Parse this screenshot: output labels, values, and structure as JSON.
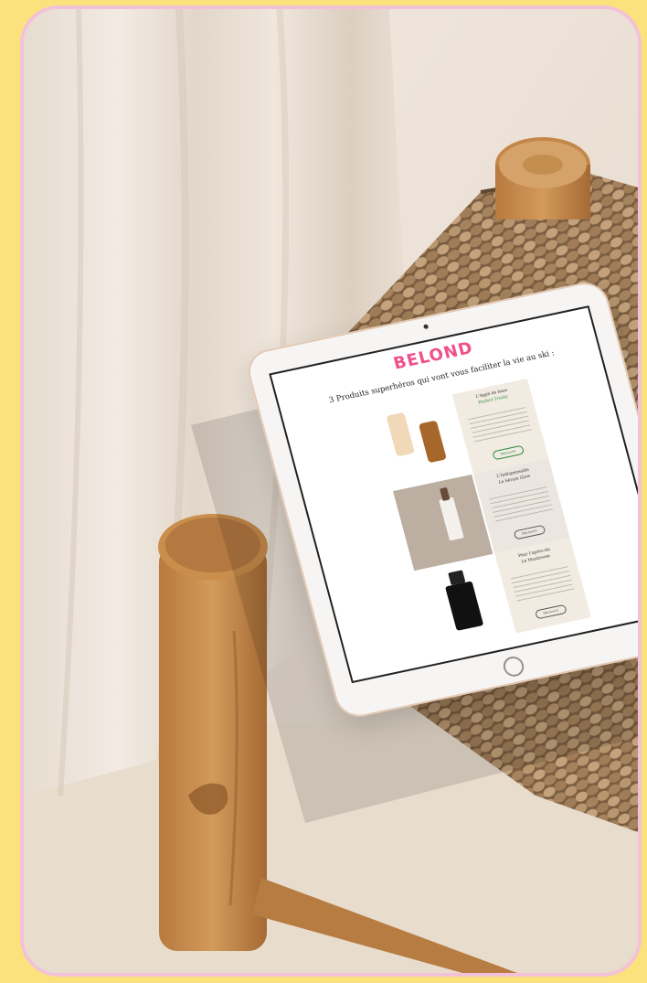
{
  "brand": {
    "logo_text": "BELOND"
  },
  "email": {
    "headline": "3 Produits superhéros qui vont vous faciliter la vie au ski :",
    "products": [
      {
        "title_line1": "L'Appli de base",
        "title_line2": "Perfect Trinity",
        "button_label": "Découvrir"
      },
      {
        "title_line1": "L'Indispensable",
        "title_line2": "Le Sérum Glow",
        "button_label": "Découvrir"
      },
      {
        "title_line1": "Pour l'après-ski",
        "title_line2": "Le Mushroom",
        "button_label": "Découvrir"
      }
    ]
  },
  "colors": {
    "page_background": "#fbe27c",
    "frame_border": "#f4c2d8",
    "logo_pink": "#f0508a",
    "card_beige": "#f1ebe2",
    "tablet_bezel": "#f7f5f3"
  }
}
